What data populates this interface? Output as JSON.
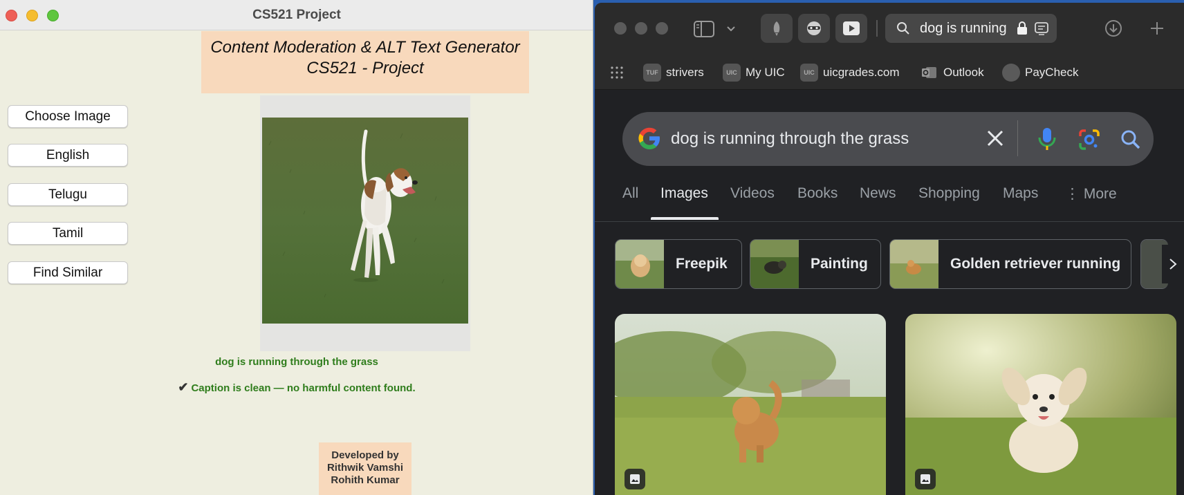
{
  "tk_window": {
    "title": "CS521 Project",
    "header_line1": "Content Moderation & ALT Text Generator",
    "header_line2": "CS521 - Project",
    "buttons": [
      "Choose Image",
      "English",
      "Telugu",
      "Tamil",
      "Find Similar"
    ],
    "caption": "dog is running through the grass",
    "moderation_check": "✔",
    "moderation_result": "Caption is clean — no harmful content found.",
    "credits": [
      "Developed by",
      "Rithwik Vamshi",
      "Rohith Kumar"
    ]
  },
  "browser": {
    "url_text": "dog is running",
    "bookmarks": [
      {
        "icon_text": "TUF",
        "label": "strivers"
      },
      {
        "icon_text": "UIC",
        "label": "My UIC"
      },
      {
        "icon_text": "UIC",
        "label": "uicgrades.com"
      },
      {
        "icon_text": "",
        "label": "Outlook"
      },
      {
        "icon_text": "",
        "label": "PayCheck"
      }
    ],
    "search_query": "dog is running through the grass",
    "tabs": [
      "All",
      "Images",
      "Videos",
      "Books",
      "News",
      "Shopping",
      "Maps",
      "More"
    ],
    "active_tab": "Images",
    "chips": [
      "Freepik",
      "Painting",
      "Golden retriever running"
    ]
  },
  "colors": {
    "tk_background": "#eeeee0",
    "header_background": "#f8d9bc",
    "caption_green": "#2f7d1c",
    "browser_background": "#202124"
  }
}
